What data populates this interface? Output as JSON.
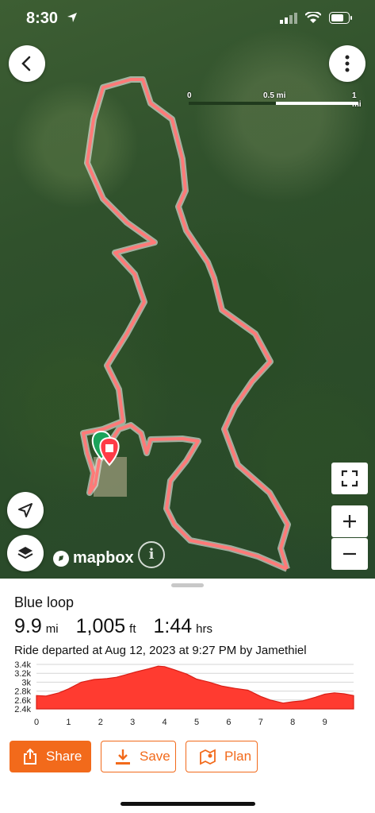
{
  "status_bar": {
    "time": "8:30"
  },
  "map": {
    "scale": {
      "labels": [
        "0",
        "0.5 mi",
        "1 mi"
      ]
    },
    "attribution": {
      "logo_text": "mapbox"
    },
    "route_color": "#ff6b6b"
  },
  "ride": {
    "name": "Blue loop",
    "distance": "9.9",
    "distance_unit": "mi",
    "elevation": "1,005",
    "elevation_unit": "ft",
    "duration": "1:44",
    "duration_unit": "hrs",
    "description": "Ride departed at Aug 12, 2023 at 9:27 PM by Jamethiel"
  },
  "chart_data": {
    "type": "area",
    "xlabel": "",
    "ylabel": "",
    "x_ticks": [
      "0",
      "1",
      "2",
      "3",
      "4",
      "5",
      "6",
      "7",
      "8",
      "9"
    ],
    "y_ticks": [
      "3.4k",
      "3.2k",
      "3k",
      "2.8k",
      "2.6k",
      "2.4k"
    ],
    "xlim": [
      0,
      9.9
    ],
    "ylim": [
      2400,
      3400
    ],
    "color": "#ff3b30",
    "x": [
      0,
      0.3,
      0.7,
      1.0,
      1.4,
      1.8,
      2.2,
      2.5,
      2.8,
      3.1,
      3.5,
      3.8,
      4.0,
      4.3,
      4.7,
      5.0,
      5.4,
      5.8,
      6.2,
      6.6,
      7.0,
      7.3,
      7.7,
      8.0,
      8.3,
      8.7,
      9.0,
      9.3,
      9.6,
      9.9
    ],
    "y": [
      2700,
      2690,
      2760,
      2850,
      3000,
      3060,
      3080,
      3110,
      3170,
      3230,
      3300,
      3360,
      3350,
      3280,
      3180,
      3070,
      3000,
      2910,
      2860,
      2820,
      2680,
      2600,
      2530,
      2560,
      2580,
      2660,
      2730,
      2760,
      2740,
      2700
    ]
  },
  "actions": {
    "share": "Share",
    "save": "Save",
    "plan": "Plan"
  },
  "colors": {
    "accent": "#f26a1b"
  }
}
